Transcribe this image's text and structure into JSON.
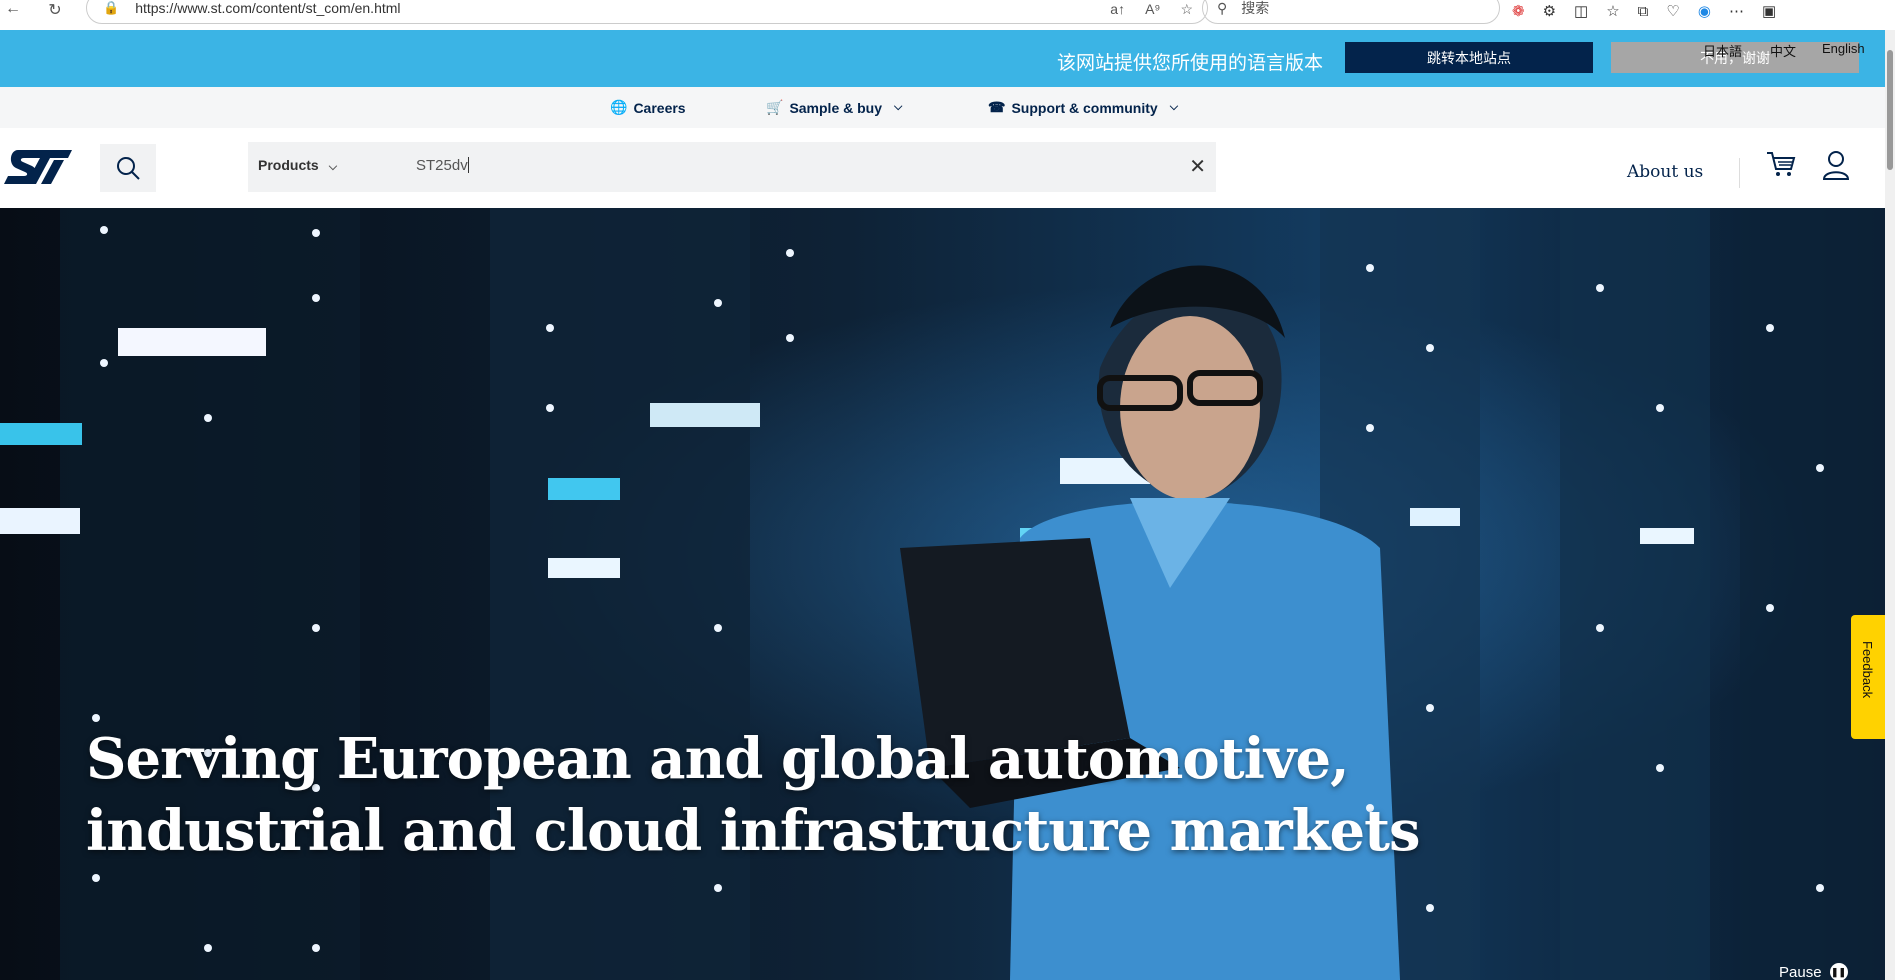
{
  "browser": {
    "url": "https://www.st.com/content/st_com/en.html",
    "search_placeholder": "搜索"
  },
  "lang_banner": {
    "message": "该网站提供您所使用的语言版本",
    "go_local_label": "跳转本地站点",
    "decline_label": "不用，谢谢",
    "languages": [
      "日本語",
      "中文",
      "English"
    ]
  },
  "secondary_nav": {
    "careers": "Careers",
    "sample_buy": "Sample & buy",
    "support": "Support & community"
  },
  "header": {
    "products_label": "Products",
    "search_value": "ST25dv",
    "about_label": "About us"
  },
  "hero": {
    "title_line1": "Serving European and global automotive,",
    "title_line2": "industrial and cloud infrastructure markets",
    "pause_label": "Pause"
  },
  "feedback_label": "Feedback",
  "colors": {
    "banner": "#3bb4e5",
    "brand_navy": "#03234b",
    "feedback": "#ffd200"
  }
}
